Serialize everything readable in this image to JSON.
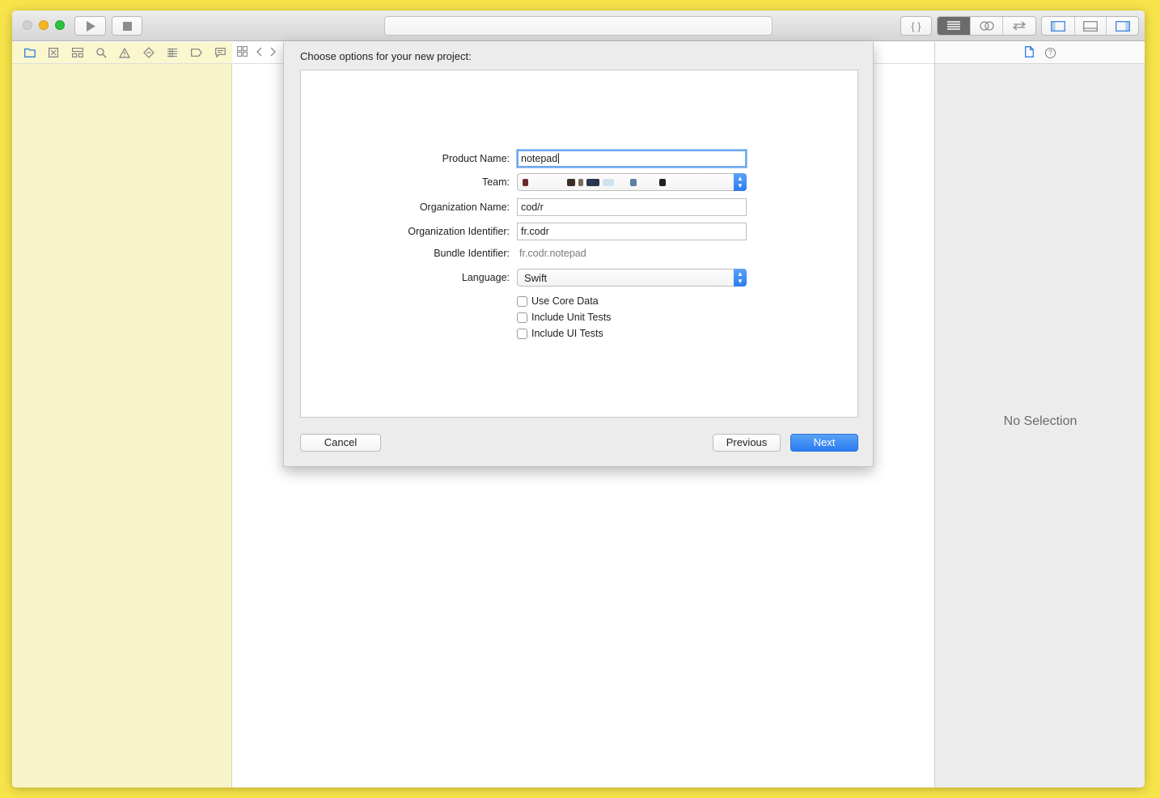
{
  "toolbar": {
    "run_icon": "play-icon",
    "stop_icon": "stop-icon",
    "editor_icon": "braces-icon",
    "mode_icons": [
      "standard-editor-icon",
      "assistant-editor-icon",
      "version-editor-icon"
    ],
    "view_icons": [
      "navigator-toggle-icon",
      "debug-area-toggle-icon",
      "utilities-toggle-icon"
    ]
  },
  "navigator": {
    "tabs": [
      "project-navigator-icon",
      "source-control-icon",
      "symbol-navigator-icon",
      "find-icon",
      "issue-icon",
      "test-icon",
      "debug-icon",
      "breakpoint-icon",
      "report-icon"
    ]
  },
  "sheet": {
    "title": "Choose options for your new project:",
    "product_name_label": "Product Name:",
    "product_name_value": "notepad",
    "team_label": "Team:",
    "org_name_label": "Organization Name:",
    "org_name_value": "cod/r",
    "org_identifier_label": "Organization Identifier:",
    "org_identifier_value": "fr.codr",
    "bundle_identifier_label": "Bundle Identifier:",
    "bundle_identifier_value": "fr.codr.notepad",
    "language_label": "Language:",
    "language_value": "Swift",
    "checkboxes": [
      {
        "label": "Use Core Data",
        "checked": false
      },
      {
        "label": "Include Unit Tests",
        "checked": false
      },
      {
        "label": "Include UI Tests",
        "checked": false
      }
    ],
    "cancel_label": "Cancel",
    "previous_label": "Previous",
    "next_label": "Next"
  },
  "inspector": {
    "no_selection": "No Selection"
  },
  "colors": {
    "desktop": "#f7e44a",
    "navigator_bg": "#f9f4c8",
    "accent": "#2f7ddf"
  }
}
